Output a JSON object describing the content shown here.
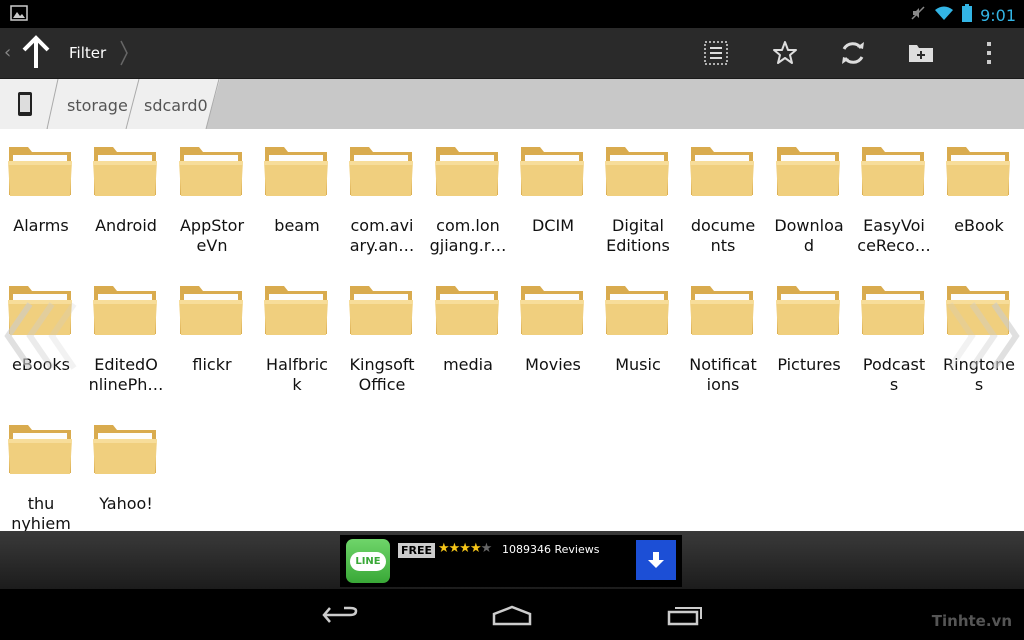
{
  "status_bar": {
    "time": "9:01"
  },
  "action_bar": {
    "title": "Filter"
  },
  "breadcrumb": {
    "segments": [
      "storage",
      "sdcard0"
    ]
  },
  "folders": [
    {
      "line1": "Alarms",
      "line2": ""
    },
    {
      "line1": "Android",
      "line2": ""
    },
    {
      "line1": "AppStor",
      "line2": "eVn"
    },
    {
      "line1": "beam",
      "line2": ""
    },
    {
      "line1": "com.avi",
      "line2": "ary.an…"
    },
    {
      "line1": "com.lon",
      "line2": "gjiang.r…"
    },
    {
      "line1": "DCIM",
      "line2": ""
    },
    {
      "line1": "Digital",
      "line2": "Editions"
    },
    {
      "line1": "docume",
      "line2": "nts"
    },
    {
      "line1": "Downloa",
      "line2": "d"
    },
    {
      "line1": "EasyVoi",
      "line2": "ceReco…"
    },
    {
      "line1": "eBook",
      "line2": ""
    },
    {
      "line1": "eBooks",
      "line2": ""
    },
    {
      "line1": "EditedO",
      "line2": "nlinePh…"
    },
    {
      "line1": "flickr",
      "line2": ""
    },
    {
      "line1": "Halfbric",
      "line2": "k"
    },
    {
      "line1": "Kingsoft",
      "line2": "Office"
    },
    {
      "line1": "media",
      "line2": ""
    },
    {
      "line1": "Movies",
      "line2": ""
    },
    {
      "line1": "Music",
      "line2": ""
    },
    {
      "line1": "Notificat",
      "line2": "ions"
    },
    {
      "line1": "Pictures",
      "line2": ""
    },
    {
      "line1": "Podcast",
      "line2": "s"
    },
    {
      "line1": "Ringtone",
      "line2": "s"
    },
    {
      "line1": "thu",
      "line2": "nyhiem"
    },
    {
      "line1": "Yahoo!",
      "line2": ""
    }
  ],
  "ad": {
    "free_label": "FREE",
    "stars": "★★★★",
    "star_empty": "★",
    "reviews": "1089346 Reviews",
    "app_icon_text": "LINE",
    "rating": 4
  },
  "watermark": "Tinhte.vn",
  "colors": {
    "accent": "#33b5e5",
    "folder": "#e8c46a",
    "ad_download": "#1c4fd6"
  }
}
